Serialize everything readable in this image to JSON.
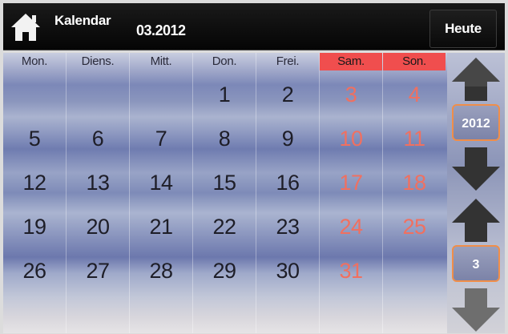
{
  "header": {
    "title": "Kalendar",
    "date": "03.2012",
    "today_button": "Heute"
  },
  "weekdays": [
    {
      "label": "Mon.",
      "weekend": false
    },
    {
      "label": "Diens.",
      "weekend": false
    },
    {
      "label": "Mitt.",
      "weekend": false
    },
    {
      "label": "Don.",
      "weekend": false
    },
    {
      "label": "Frei.",
      "weekend": false
    },
    {
      "label": "Sam.",
      "weekend": true
    },
    {
      "label": "Son.",
      "weekend": true
    }
  ],
  "weeks": [
    [
      "",
      "",
      "",
      "1",
      "2",
      "3",
      "4"
    ],
    [
      "5",
      "6",
      "7",
      "8",
      "9",
      "10",
      "11"
    ],
    [
      "12",
      "13",
      "14",
      "15",
      "16",
      "17",
      "18"
    ],
    [
      "19",
      "20",
      "21",
      "22",
      "23",
      "24",
      "25"
    ],
    [
      "26",
      "27",
      "28",
      "29",
      "30",
      "31",
      ""
    ],
    [
      "",
      "",
      "",
      "",
      "",
      "",
      ""
    ]
  ],
  "side": {
    "year": "2012",
    "month": "3"
  },
  "colors": {
    "weekend_header": "#f04e4e",
    "weekend_text": "#f07060",
    "selector_border": "#f08e4a"
  },
  "icons": {
    "home": "home-icon",
    "up": "arrow-up-icon",
    "down": "arrow-down-icon"
  }
}
